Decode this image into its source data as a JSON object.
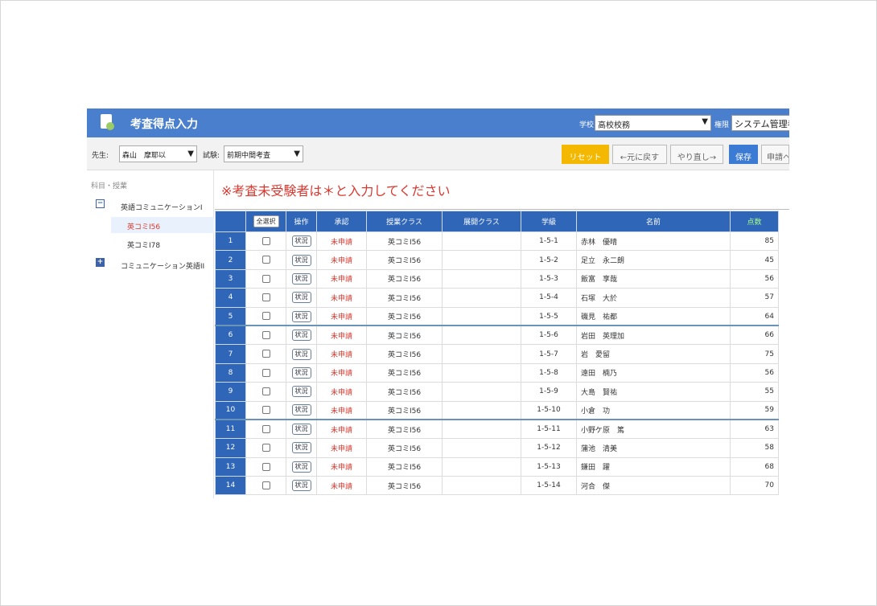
{
  "header": {
    "title": "考査得点入力",
    "school_label": "学校",
    "school_value": "高校校務",
    "role_label": "権限",
    "role_value": "システム管理者"
  },
  "toolbar": {
    "teacher_label": "先生:",
    "teacher_value": "森山　摩耶以",
    "exam_label": "試験:",
    "exam_value": "前期中間考査",
    "reset_label": "リセット",
    "undo_label": "←元に戻す",
    "redo_label": "やり直し→",
    "save_label": "保存",
    "apply_label": "申請へ"
  },
  "sidebar": {
    "heading": "科目・授業",
    "groups": [
      {
        "label": "英語コミュニケーションI",
        "expanded": true,
        "items": [
          "英コミI56",
          "英コミI78"
        ],
        "selected": "英コミI56"
      },
      {
        "label": "コミュニケーション英語II",
        "expanded": false
      }
    ]
  },
  "main": {
    "notice": "※考査未受験者は＊と入力してください",
    "columns": {
      "select_all": "全選択",
      "action": "操作",
      "approval": "承認",
      "class": "授業クラス",
      "open_class": "展開クラス",
      "student_no": "学級",
      "name": "名前",
      "score": "点数"
    },
    "status_button": "状況",
    "rows": [
      {
        "no": "1",
        "approval": "未申請",
        "class": "英コミI56",
        "open_class": "",
        "student_no": "1-5-1",
        "name": "赤林　優晴",
        "score": "85"
      },
      {
        "no": "2",
        "approval": "未申請",
        "class": "英コミI56",
        "open_class": "",
        "student_no": "1-5-2",
        "name": "足立　永二朗",
        "score": "45"
      },
      {
        "no": "3",
        "approval": "未申請",
        "class": "英コミI56",
        "open_class": "",
        "student_no": "1-5-3",
        "name": "飯富　享哉",
        "score": "56"
      },
      {
        "no": "4",
        "approval": "未申請",
        "class": "英コミI56",
        "open_class": "",
        "student_no": "1-5-4",
        "name": "石塚　大於",
        "score": "57"
      },
      {
        "no": "5",
        "approval": "未申請",
        "class": "英コミI56",
        "open_class": "",
        "student_no": "1-5-5",
        "name": "磯見　祐都",
        "score": "64"
      },
      {
        "no": "6",
        "approval": "未申請",
        "class": "英コミI56",
        "open_class": "",
        "student_no": "1-5-6",
        "name": "岩田　英理加",
        "score": "66"
      },
      {
        "no": "7",
        "approval": "未申請",
        "class": "英コミI56",
        "open_class": "",
        "student_no": "1-5-7",
        "name": "岩　愛留",
        "score": "75"
      },
      {
        "no": "8",
        "approval": "未申請",
        "class": "英コミI56",
        "open_class": "",
        "student_no": "1-5-8",
        "name": "遠田　楠乃",
        "score": "56"
      },
      {
        "no": "9",
        "approval": "未申請",
        "class": "英コミI56",
        "open_class": "",
        "student_no": "1-5-9",
        "name": "大島　賢祐",
        "score": "55"
      },
      {
        "no": "10",
        "approval": "未申請",
        "class": "英コミI56",
        "open_class": "",
        "student_no": "1-5-10",
        "name": "小倉　功",
        "score": "59"
      },
      {
        "no": "11",
        "approval": "未申請",
        "class": "英コミI56",
        "open_class": "",
        "student_no": "1-5-11",
        "name": "小野ケ原　篤",
        "score": "63"
      },
      {
        "no": "12",
        "approval": "未申請",
        "class": "英コミI56",
        "open_class": "",
        "student_no": "1-5-12",
        "name": "蒲池　清美",
        "score": "58"
      },
      {
        "no": "13",
        "approval": "未申請",
        "class": "英コミI56",
        "open_class": "",
        "student_no": "1-5-13",
        "name": "鎌田　躍",
        "score": "68"
      },
      {
        "no": "14",
        "approval": "未申請",
        "class": "英コミI56",
        "open_class": "",
        "student_no": "1-5-14",
        "name": "河合　傑",
        "score": "70"
      }
    ]
  },
  "colors": {
    "header_bg": "#4a7fcd",
    "table_header_bg": "#2f66b8",
    "accent_red": "#d9382f",
    "reset_yellow": "#f5b800",
    "save_blue": "#3c7bd4"
  }
}
